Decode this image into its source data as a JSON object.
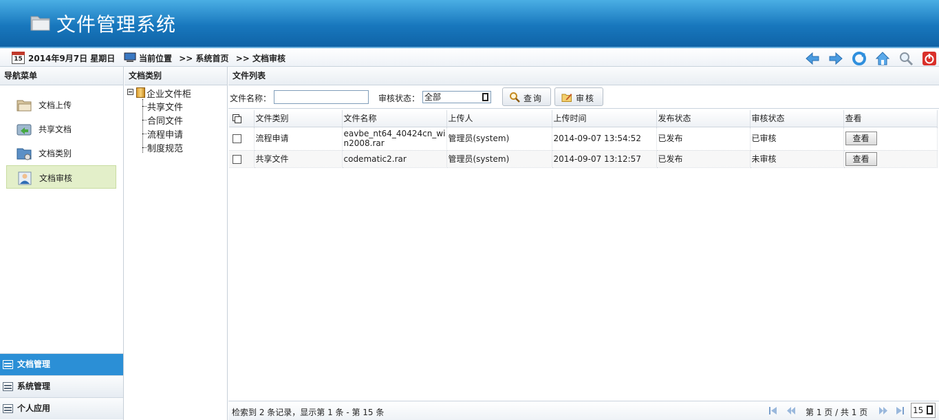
{
  "app": {
    "title": "文件管理系统"
  },
  "topbar": {
    "calendar_day": "15",
    "date": "2014年9月7日 星期日",
    "location_label": "当前位置",
    "crumbs": [
      ">> 系统首页",
      ">> 文档审核"
    ],
    "icons": [
      "back-arrow-icon",
      "forward-arrow-icon",
      "refresh-icon",
      "home-icon",
      "search-icon",
      "power-icon"
    ]
  },
  "nav": {
    "title": "导航菜单",
    "items": [
      {
        "label": "文档上传",
        "icon": "folder-icon"
      },
      {
        "label": "共享文档",
        "icon": "share-icon"
      },
      {
        "label": "文档类别",
        "icon": "folder-settings-icon"
      },
      {
        "label": "文档审核",
        "icon": "user-icon",
        "active": true
      }
    ],
    "accordion": [
      {
        "label": "文档管理",
        "active": true
      },
      {
        "label": "系统管理"
      },
      {
        "label": "个人应用"
      }
    ]
  },
  "tree": {
    "title": "文档类别",
    "root": "企业文件柜",
    "children": [
      "共享文件",
      "合同文件",
      "流程申请",
      "制度规范"
    ]
  },
  "main": {
    "title": "文件列表",
    "search": {
      "name_label": "文件名称：",
      "name_value": "",
      "status_label": "审核状态：",
      "status_value": "全部",
      "query_btn": "查询",
      "audit_btn": "审核"
    },
    "table": {
      "headers": [
        "文件类别",
        "文件名称",
        "上传人",
        "上传时间",
        "发布状态",
        "审核状态",
        "查看"
      ],
      "rows": [
        {
          "category": "流程申请",
          "name": "eavbe_nt64_40424cn_win2008.rar",
          "uploader": "管理员(system)",
          "time": "2014-09-07 13:54:52",
          "publish": "已发布",
          "audit": "已审核",
          "view": "查看"
        },
        {
          "category": "共享文件",
          "name": "codematic2.rar",
          "uploader": "管理员(system)",
          "time": "2014-09-07 13:12:57",
          "publish": "已发布",
          "audit": "未审核",
          "view": "查看"
        }
      ]
    },
    "pager": {
      "info": "检索到 2 条记录，显示第 1 条 - 第 15 条",
      "pages": "第 1 页 / 共 1 页",
      "page_size": "15"
    }
  }
}
